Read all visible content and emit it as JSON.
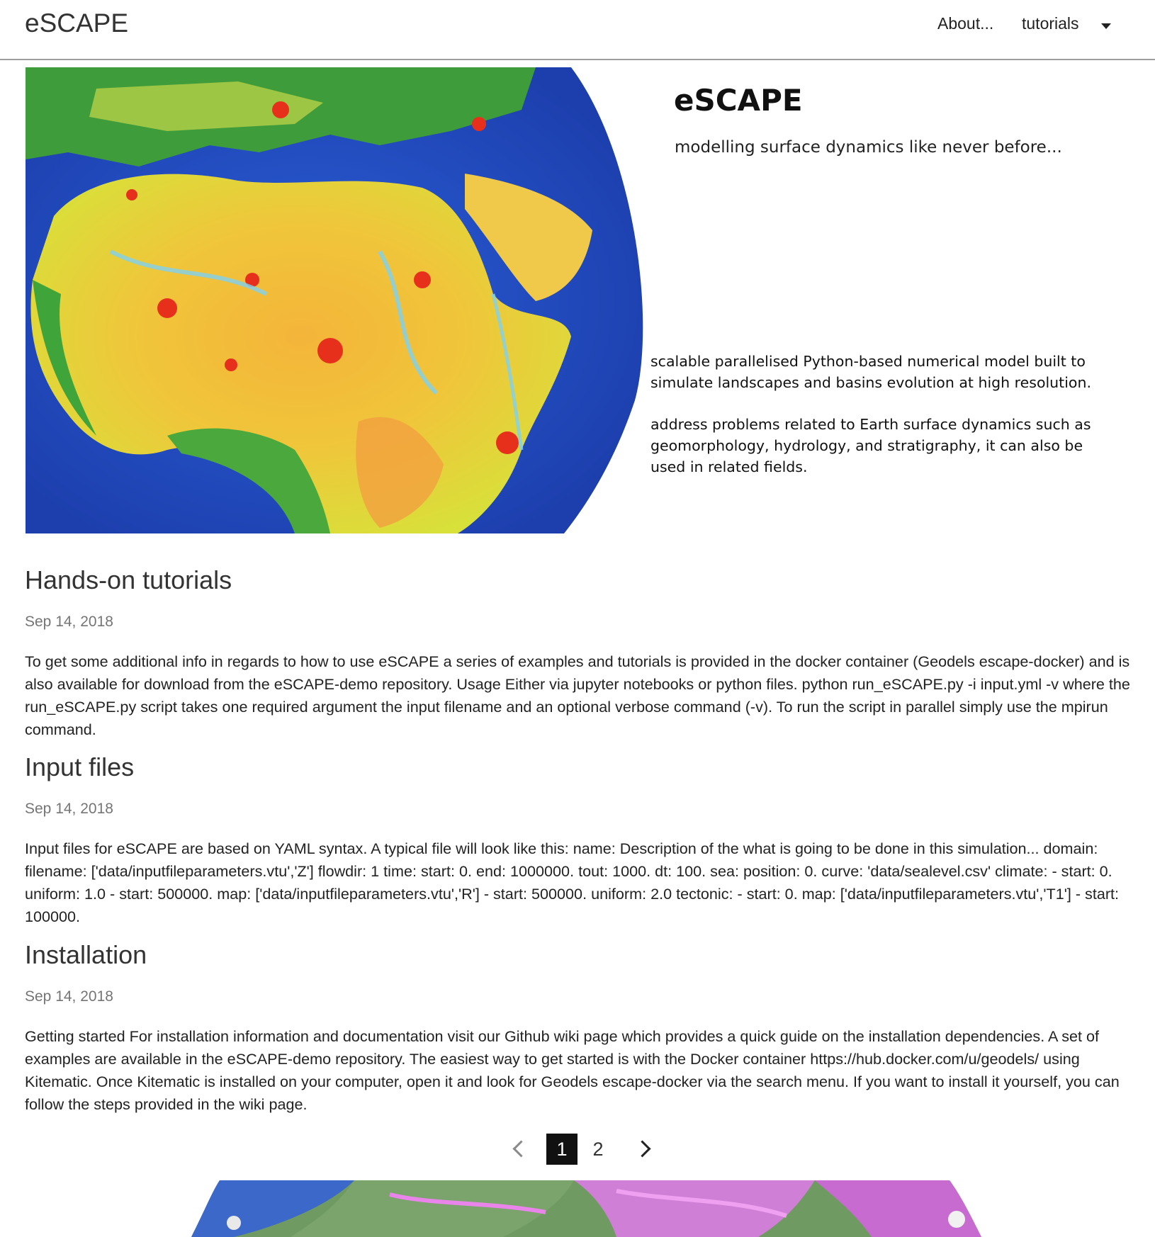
{
  "nav": {
    "brand": "eSCAPE",
    "about": "About...",
    "tutorials": "tutorials"
  },
  "hero": {
    "title": "eSCAPE",
    "tagline": "modelling surface dynamics like never before...",
    "desc1": "scalable parallelised Python-based numerical model built to simulate landscapes and basins evolution at high resolution.",
    "desc2": "address problems related to Earth surface dynamics such as geomorphology, hydrology, and stratigraphy, it can also be used in related fields."
  },
  "posts": [
    {
      "title": "Hands-on tutorials",
      "date": "Sep 14, 2018",
      "body": "To get some additional info in regards to how to use eSCAPE a series of examples and tutorials is provided in the docker container (Geodels escape-docker) and is also available for download from the eSCAPE-demo repository. Usage Either via jupyter notebooks or python files. python run_eSCAPE.py -i input.yml -v where the run_eSCAPE.py script takes one required argument the input filename and an optional verbose command (-v). To run the script in parallel simply use the mpirun command."
    },
    {
      "title": "Input files",
      "date": "Sep 14, 2018",
      "body": "Input files for eSCAPE are based on YAML syntax. A typical file will look like this: name: Description of the what is going to be done in this simulation... domain: filename: ['data/inputfileparameters.vtu','Z'] flowdir: 1 time: start: 0. end: 1000000. tout: 1000. dt: 100. sea: position: 0. curve: 'data/sealevel.csv' climate: - start: 0. uniform: 1.0 - start: 500000. map: ['data/inputfileparameters.vtu','R'] - start: 500000. uniform: 2.0 tectonic: - start: 0. map: ['data/inputfileparameters.vtu','T1'] - start: 100000."
    },
    {
      "title": "Installation",
      "date": "Sep 14, 2018",
      "body": "Getting started For installation information and documentation visit our Github wiki page which provides a quick guide on the installation dependencies. A set of examples are available in the eSCAPE-demo repository. The easiest way to get started is with the Docker container https://hub.docker.com/u/geodels/ using Kitematic. Once Kitematic is installed on your computer, open it and look for Geodels escape-docker via the search menu. If you want to install it yourself, you can follow the steps provided in the wiki page."
    }
  ],
  "pagination": {
    "pages": [
      "1",
      "2"
    ],
    "current": "1"
  },
  "icons": {
    "dropdown": "caret-down-icon",
    "prev": "chevron-left-icon",
    "next": "chevron-right-icon"
  }
}
